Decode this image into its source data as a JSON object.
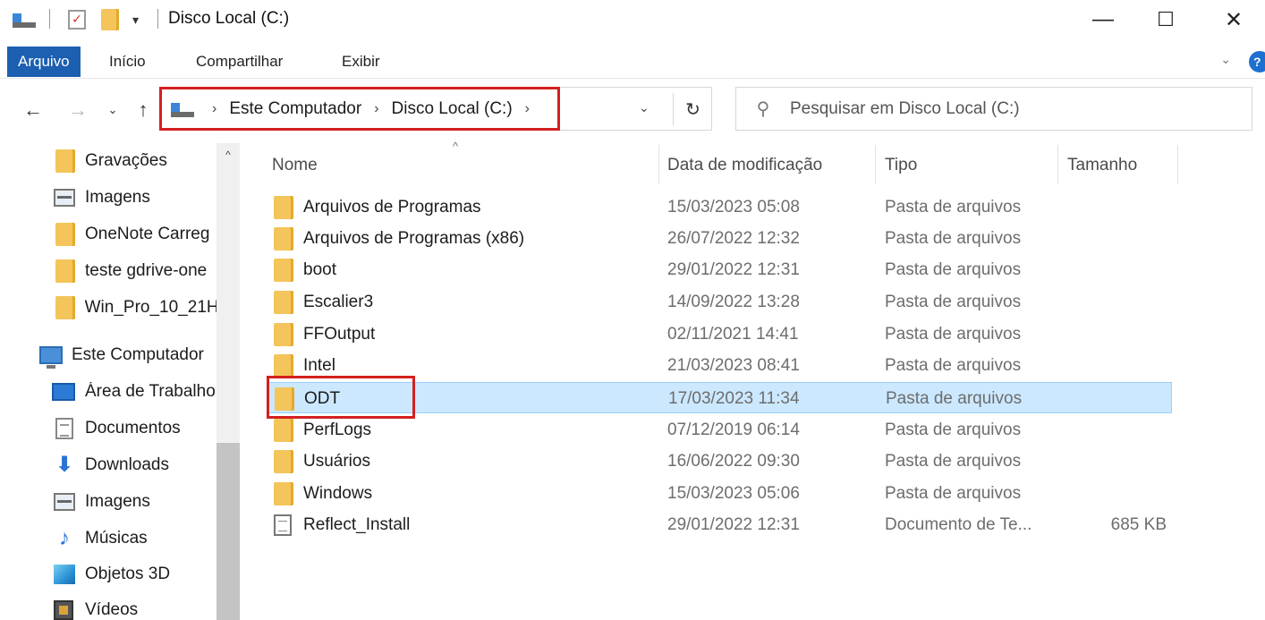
{
  "window": {
    "title": "Disco Local (C:)",
    "qa_dropdown": "▾",
    "minimize": "—",
    "maximize": "☐",
    "close": "✕"
  },
  "ribbon": {
    "tabs": [
      {
        "label": "Arquivo",
        "active": true
      },
      {
        "label": "Início"
      },
      {
        "label": "Compartilhar"
      },
      {
        "label": "Exibir"
      }
    ],
    "expand_chevron": "⌄",
    "help": "?"
  },
  "nav": {
    "back": "←",
    "forward": "→",
    "recent": "⌄",
    "up": "↑",
    "breadcrumb": [
      "Este Computador",
      "Disco Local (C:)"
    ],
    "crumb_sep": "›",
    "address_dropdown": "⌄",
    "refresh": "↻",
    "search_placeholder": "Pesquisar em Disco Local (C:)",
    "search_icon_glyph": "⚲"
  },
  "sidebar": {
    "scroll_up": "^",
    "items": [
      {
        "label": "Gravações",
        "icon": "folder-icon"
      },
      {
        "label": "Imagens",
        "icon": "image-icon"
      },
      {
        "label": "OneNote Carreg",
        "icon": "folder-icon"
      },
      {
        "label": "teste gdrive-one",
        "icon": "folder-icon"
      },
      {
        "label": "Win_Pro_10_21H",
        "icon": "folder-icon"
      },
      {
        "label": "Este Computador",
        "icon": "computer-icon"
      },
      {
        "label": "Área de Trabalho",
        "icon": "desktop-icon"
      },
      {
        "label": "Documentos",
        "icon": "document-icon"
      },
      {
        "label": "Downloads",
        "icon": "download-icon"
      },
      {
        "label": "Imagens",
        "icon": "image-icon"
      },
      {
        "label": "Músicas",
        "icon": "music-icon"
      },
      {
        "label": "Objetos 3D",
        "icon": "3d-objects-icon"
      },
      {
        "label": "Vídeos",
        "icon": "video-icon"
      }
    ]
  },
  "columns": {
    "sort_arrow": "^",
    "name": "Nome",
    "date": "Data de modificação",
    "type": "Tipo",
    "size": "Tamanho"
  },
  "files": [
    {
      "name": "Arquivos de Programas",
      "date": "15/03/2023 05:08",
      "type": "Pasta de arquivos",
      "size": ""
    },
    {
      "name": "Arquivos de Programas (x86)",
      "date": "26/07/2022 12:32",
      "type": "Pasta de arquivos",
      "size": ""
    },
    {
      "name": "boot",
      "date": "29/01/2022 12:31",
      "type": "Pasta de arquivos",
      "size": ""
    },
    {
      "name": "Escalier3",
      "date": "14/09/2022 13:28",
      "type": "Pasta de arquivos",
      "size": ""
    },
    {
      "name": "FFOutput",
      "date": "02/11/2021 14:41",
      "type": "Pasta de arquivos",
      "size": ""
    },
    {
      "name": "Intel",
      "date": "21/03/2023 08:41",
      "type": "Pasta de arquivos",
      "size": ""
    },
    {
      "name": "ODT",
      "date": "17/03/2023 11:34",
      "type": "Pasta de arquivos",
      "size": "",
      "selected": true
    },
    {
      "name": "PerfLogs",
      "date": "07/12/2019 06:14",
      "type": "Pasta de arquivos",
      "size": ""
    },
    {
      "name": "Usuários",
      "date": "16/06/2022 09:30",
      "type": "Pasta de arquivos",
      "size": ""
    },
    {
      "name": "Windows",
      "date": "15/03/2023 05:06",
      "type": "Pasta de arquivos",
      "size": ""
    },
    {
      "name": "Reflect_Install",
      "date": "29/01/2022 12:31",
      "type": "Documento de Te...",
      "size": "685 KB",
      "icon": "text-file-icon"
    }
  ],
  "colors": {
    "accent": "#1d5fb0",
    "selection": "#cce8ff",
    "highlight_box": "#d32020",
    "folder": "#f3c55a"
  }
}
